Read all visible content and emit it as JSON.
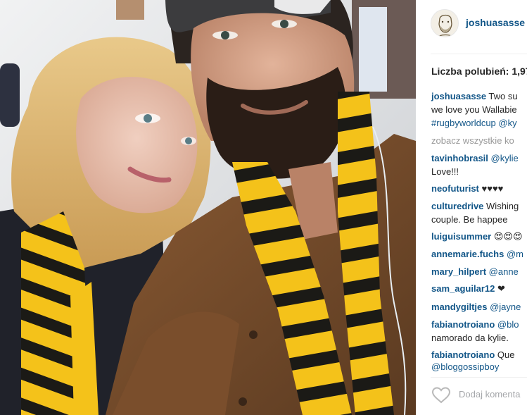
{
  "post": {
    "username": "joshuasasse",
    "likes_text": "Liczba polubień: 1,97",
    "caption": {
      "author": "joshuasasse",
      "line1_text": " Two su",
      "line2_text": "we love you Wallabie",
      "line3_hashtag": "#rugbyworldcup",
      "line3_mention": " @ky"
    },
    "view_all_text": "zobacz wszystkie ko",
    "add_comment_placeholder": "Dodaj komenta"
  },
  "comments": [
    {
      "user": "tavinhobrasil",
      "text": " @kylie",
      "line2": "Love!!!"
    },
    {
      "user": "neofuturist",
      "text": " ♥♥♥♥"
    },
    {
      "user": "culturedrive",
      "text": " Wishing",
      "line2": "couple. Be happee"
    },
    {
      "user": "luiguisummer",
      "text": " 😍😍😍"
    },
    {
      "user": "annemarie.fuchs",
      "text": " @m"
    },
    {
      "user": "mary_hilpert",
      "text": " @anne"
    },
    {
      "user": "sam_aguilar12",
      "text": " ❤"
    },
    {
      "user": "mandygiltjes",
      "text": " @jayne"
    },
    {
      "user": "fabianotroiano",
      "text": " @blo",
      "line2": "namorado da kylie."
    },
    {
      "user": "fabianotroiano",
      "text": " Que",
      "line2": "@bloggossipboy"
    }
  ],
  "icons": {
    "avatar": "profile-sketch",
    "like": "heart-outline-icon"
  },
  "colors": {
    "username": "#125688",
    "text": "#262626",
    "muted": "#999999",
    "scarf_yellow": "#f4c21a",
    "scarf_black": "#1b1a16"
  }
}
